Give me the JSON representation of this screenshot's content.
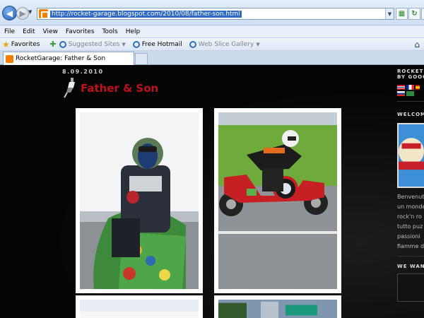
{
  "browser": {
    "url": "http://rocket-garage.blogspot.com/2010/08/father-son.html",
    "menu": [
      "File",
      "Edit",
      "View",
      "Favorites",
      "Tools",
      "Help"
    ],
    "favorites_label": "Favorites",
    "fav_links": [
      {
        "label": "Suggested Sites",
        "muted": true
      },
      {
        "label": "Free Hotmail",
        "muted": false
      },
      {
        "label": "Web Slice Gallery",
        "muted": true
      }
    ],
    "tab_title": "RocketGarage: Father & Son"
  },
  "post": {
    "date": "8.09.2010",
    "title": "Father & Son"
  },
  "sidebar": {
    "heading_1": "ROCKETG",
    "heading_2": "BY GOOG",
    "welcome": "WELCOME",
    "text_lines": [
      "Benvenut",
      "un monde",
      "rock'n ro",
      "tutto puz",
      "passioni",
      "fiamme d"
    ],
    "want": "WE WANT"
  },
  "colors": {
    "accent": "#c0101a",
    "background": "#000000",
    "photo_frame": "#ffffff"
  }
}
